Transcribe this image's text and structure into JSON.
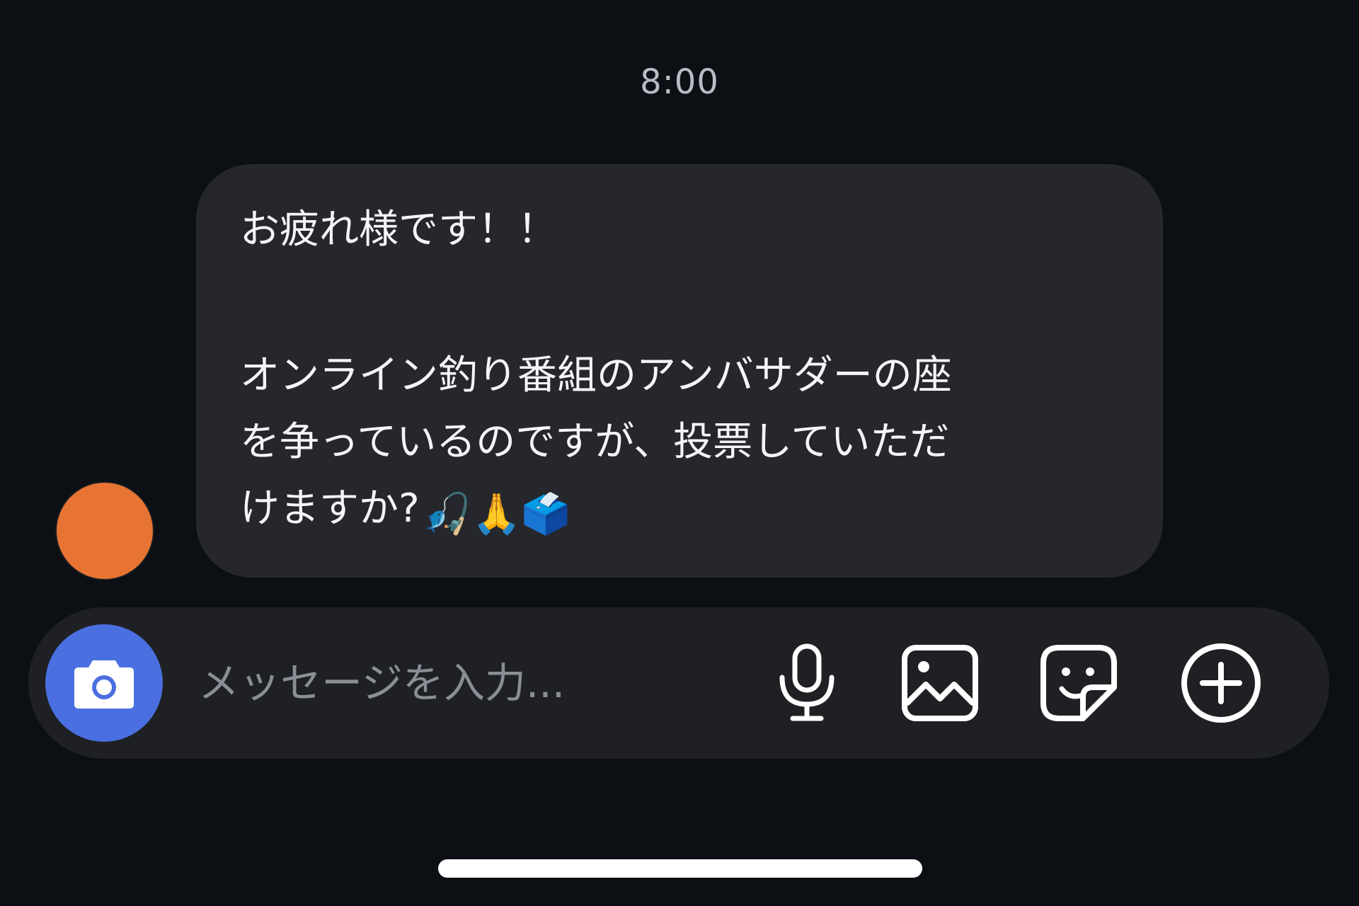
{
  "chat": {
    "timestamp": "8:00",
    "message": {
      "line1": "お疲れ様です！！",
      "line2": "オンライン釣り番組のアンバサダーの座",
      "line3": "を争っているのですが、投票していただ",
      "line4": "けますか?",
      "emojis": "🎣🙏🗳️"
    }
  },
  "composer": {
    "placeholder": "メッセージを入力...",
    "icons": {
      "camera": "camera-icon",
      "microphone": "microphone-icon",
      "image": "image-icon",
      "sticker": "sticker-icon",
      "add": "plus-circle-icon"
    }
  },
  "colors": {
    "background": "#0c0f14",
    "bubble": "#25272c",
    "avatar": "#e87433",
    "camera_button": "#4a6fe0",
    "input_bar": "#1e2024"
  }
}
